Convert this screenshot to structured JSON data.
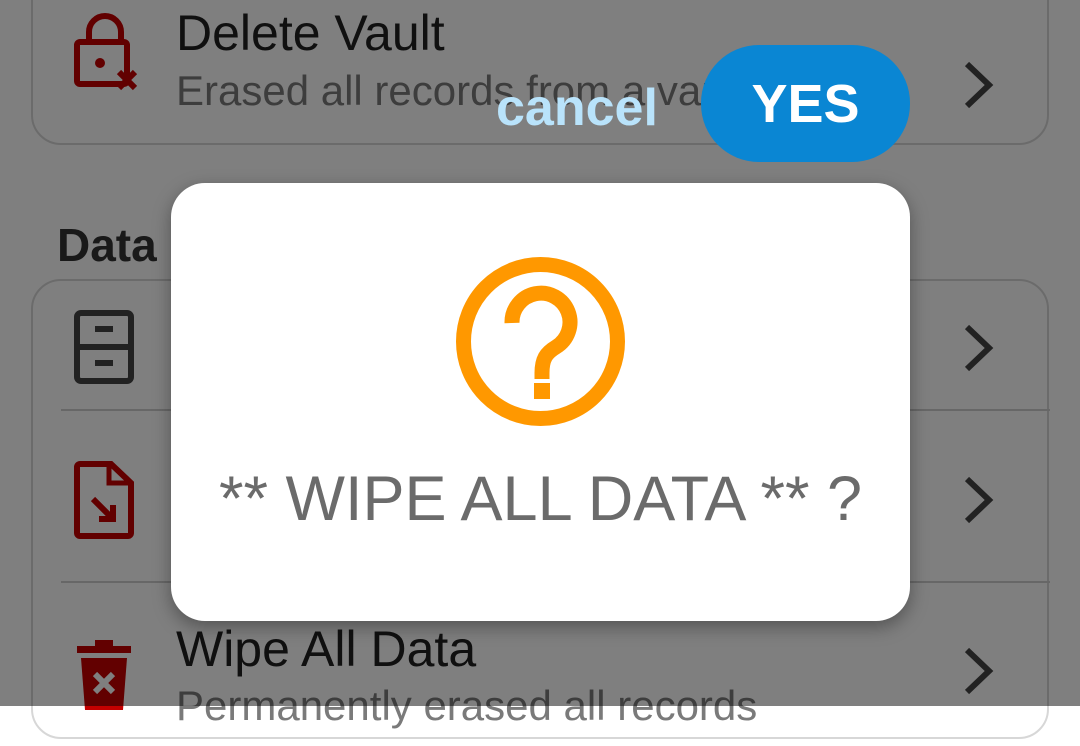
{
  "settings": {
    "delete_vault": {
      "title": "Delete Vault",
      "subtitle": "Erased all records from a vault"
    },
    "data_section_label": "Data",
    "wipe_all": {
      "title": "Wipe All Data",
      "subtitle": "Permanently erased all records"
    }
  },
  "dialog": {
    "icon": "question-circle-icon",
    "message": "** WIPE ALL DATA ** ?",
    "cancel_label": "cancel",
    "confirm_label": "YES"
  },
  "colors": {
    "accent_orange": "#ff9800",
    "confirm_blue": "#0a86d3",
    "danger_red": "#c40000"
  }
}
